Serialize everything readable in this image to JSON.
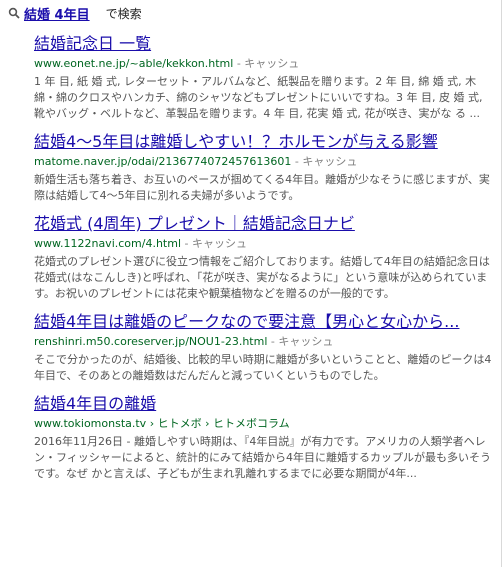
{
  "search": {
    "query": "結婚 4年目",
    "suffix": "で検索"
  },
  "cache_label": "キャッシュ",
  "results": [
    {
      "title": "結婚記念日 一覧",
      "url": "www.eonet.ne.jp/~able/kekkon.html",
      "snippet": "1 年 目, 紙 婚 式, レターセット・アルバムなど、紙製品を贈ります。2 年 目, 綿 婚 式, 木綿・綿のクロスやハンカチ、綿のシャツなどもプレゼントにいいですね。3 年 目, 皮 婚 式, 靴やバッグ・ベルトなど、革製品を贈ります。4 年 目, 花実 婚 式, 花が咲き、実がな る ..."
    },
    {
      "title": "結婚4～5年目は離婚しやすい！？ホルモンが与える影響",
      "url": "matome.naver.jp/odai/2136774072457613601",
      "snippet": "新婚生活も落ち着き、お互いのペースが掴めてくる4年目。離婚が少なそうに感じますが、実際は結婚して4～5年目に別れる夫婦が多いようです。"
    },
    {
      "title": "花婚式 (4周年) プレゼント｜結婚記念日ナビ",
      "url": "www.1122navi.com/4.html",
      "snippet": "花婚式のプレゼント選びに役立つ情報をご紹介しております。結婚して4年目の結婚記念日は花婚式(はなこんしき)と呼ばれ、「花が咲き、実がなるように」という意味が込められています。お祝いのプレゼントには花束や観葉植物などを贈るのが一般的です。"
    },
    {
      "title": "結婚4年目は離婚のピークなので要注意【男心と女心から...",
      "url": "renshinri.m50.coreserver.jp/NOU1-23.html",
      "snippet": "そこで分かったのが、結婚後、比較的早い時期に離婚が多いということと、離婚のピークは4年目で、そのあとの離婚数はだんだんと減っていくというものでした。"
    },
    {
      "title": "結婚4年目の離婚",
      "url": "www.tokiomonsta.tv › ヒトメボ › ヒトメボコラム",
      "snippet": "2016年11月26日 - 離婚しやすい時期は、『4年目説』が有力です。アメリカの人類学者ヘレン・フィッシャーによると、統計的にみて結婚から4年目に離婚するカップルが最も多いそうです。なぜ かと言えば、子どもが生まれ乳離れするまでに必要な期間が4年..."
    }
  ]
}
